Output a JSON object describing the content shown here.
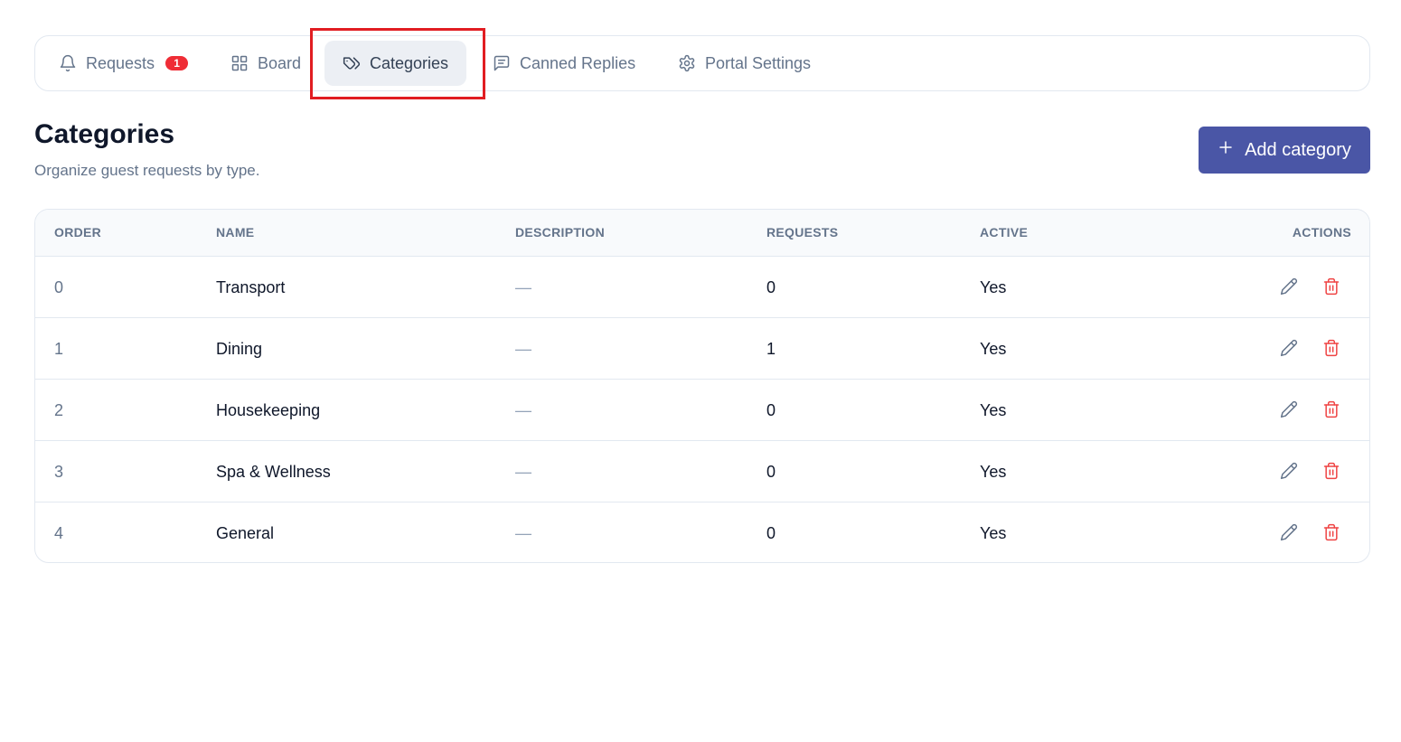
{
  "nav": {
    "tabs": [
      {
        "label": "Requests",
        "icon": "bell-icon",
        "badge": "1"
      },
      {
        "label": "Board",
        "icon": "grid-icon"
      },
      {
        "label": "Categories",
        "icon": "tag-icon",
        "active": true
      },
      {
        "label": "Canned Replies",
        "icon": "message-icon"
      },
      {
        "label": "Portal Settings",
        "icon": "gear-icon"
      }
    ]
  },
  "header": {
    "title": "Categories",
    "subtitle": "Organize guest requests by type.",
    "add_button_label": "Add category"
  },
  "table": {
    "columns": [
      "Order",
      "Name",
      "Description",
      "Requests",
      "Active",
      "Actions"
    ],
    "rows": [
      {
        "order": "0",
        "name": "Transport",
        "description": "—",
        "requests": "0",
        "active": "Yes"
      },
      {
        "order": "1",
        "name": "Dining",
        "description": "—",
        "requests": "1",
        "active": "Yes"
      },
      {
        "order": "2",
        "name": "Housekeeping",
        "description": "—",
        "requests": "0",
        "active": "Yes"
      },
      {
        "order": "3",
        "name": "Spa & Wellness",
        "description": "—",
        "requests": "0",
        "active": "Yes"
      },
      {
        "order": "4",
        "name": "General",
        "description": "—",
        "requests": "0",
        "active": "Yes"
      }
    ]
  },
  "colors": {
    "accent": "#4a56a6",
    "badge": "#ef2d36",
    "delete": "#ef4444",
    "highlight": "#e11d22"
  }
}
